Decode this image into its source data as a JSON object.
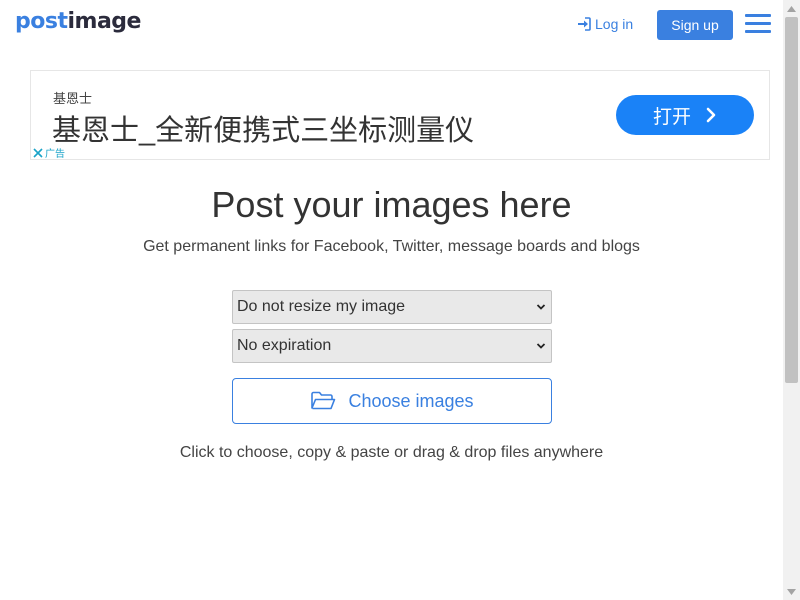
{
  "brand": {
    "logo_part1": "post",
    "logo_part2": "image"
  },
  "nav": {
    "login_label": "Log in",
    "signup_label": "Sign up",
    "login_icon": "sign-in-icon",
    "menu_icon": "hamburger-icon"
  },
  "ad": {
    "small_text": "基恩士",
    "headline": "基恩士_全新便携式三坐标测量仪",
    "button_label": "打开",
    "ad_label": "广告"
  },
  "hero": {
    "title": "Post your images here",
    "subtitle": "Get permanent links for Facebook, Twitter, message boards and blogs"
  },
  "form": {
    "resize_selected": "Do not resize my image",
    "expiration_selected": "No expiration",
    "choose_label": "Choose images",
    "choose_icon": "folder-open-icon",
    "hint": "Click to choose, copy & paste or drag & drop files anywhere"
  },
  "colors": {
    "accent": "#3a80e0",
    "ad_button": "#1a82f7",
    "ad_close": "#1aa3c8"
  }
}
